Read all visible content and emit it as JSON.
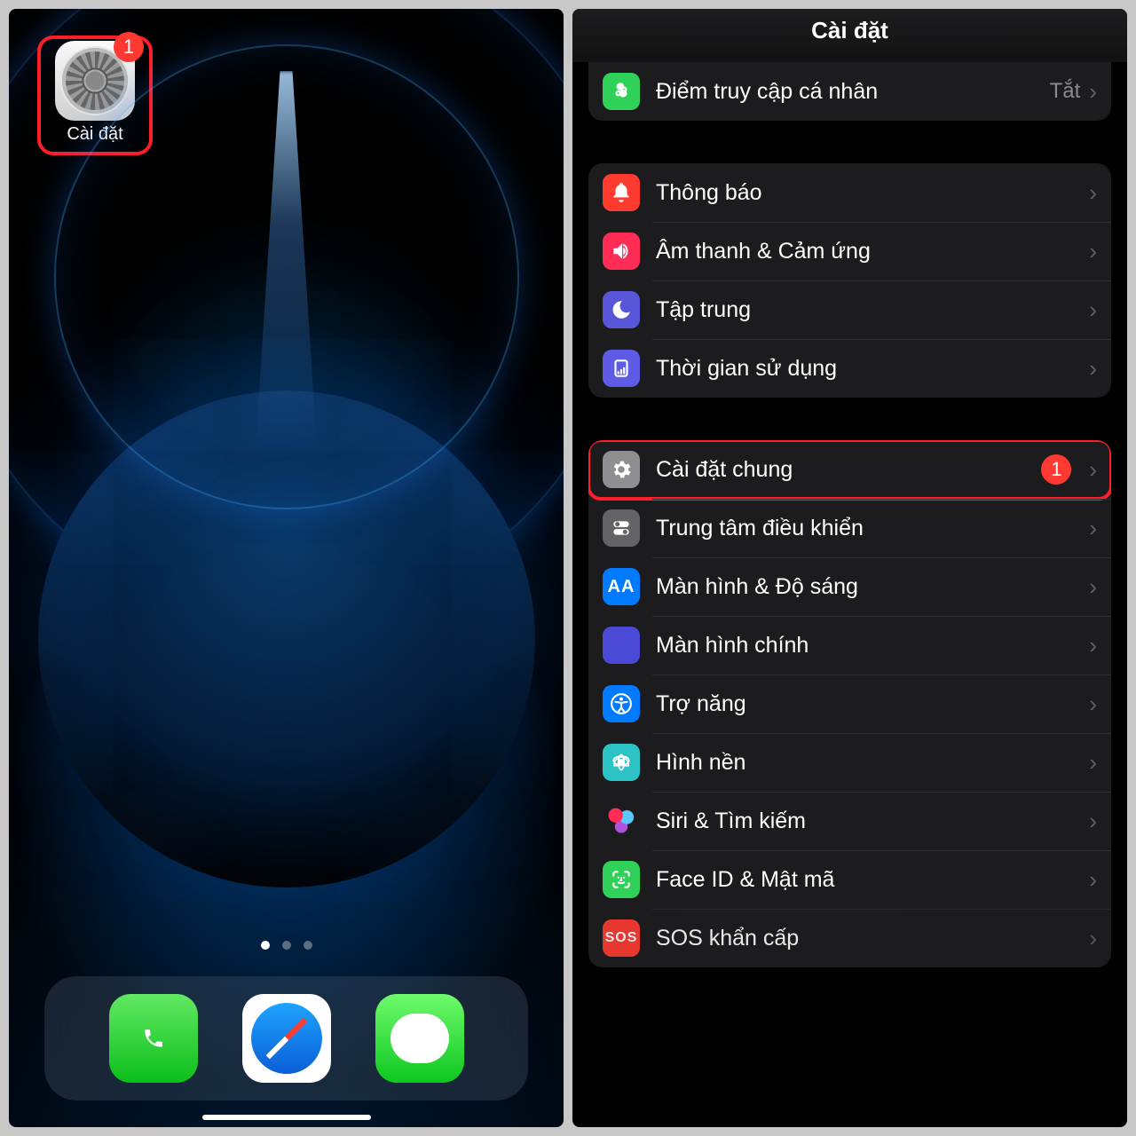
{
  "left": {
    "app_label": "Cài đặt",
    "badge_count": "1"
  },
  "right": {
    "header_title": "Cài đặt",
    "group_top": {
      "hotspot_label": "Điểm truy cập cá nhân",
      "hotspot_value": "Tắt"
    },
    "group_mid": {
      "notifications": "Thông báo",
      "sounds": "Âm thanh & Cảm ứng",
      "focus": "Tập trung",
      "screentime": "Thời gian sử dụng"
    },
    "group_big": {
      "general": "Cài đặt chung",
      "general_badge": "1",
      "control_center": "Trung tâm điều khiển",
      "display": "Màn hình & Độ sáng",
      "home_screen": "Màn hình chính",
      "accessibility": "Trợ năng",
      "wallpaper": "Hình nền",
      "siri": "Siri & Tìm kiếm",
      "faceid": "Face ID & Mật mã",
      "sos": "SOS khẩn cấp"
    }
  }
}
